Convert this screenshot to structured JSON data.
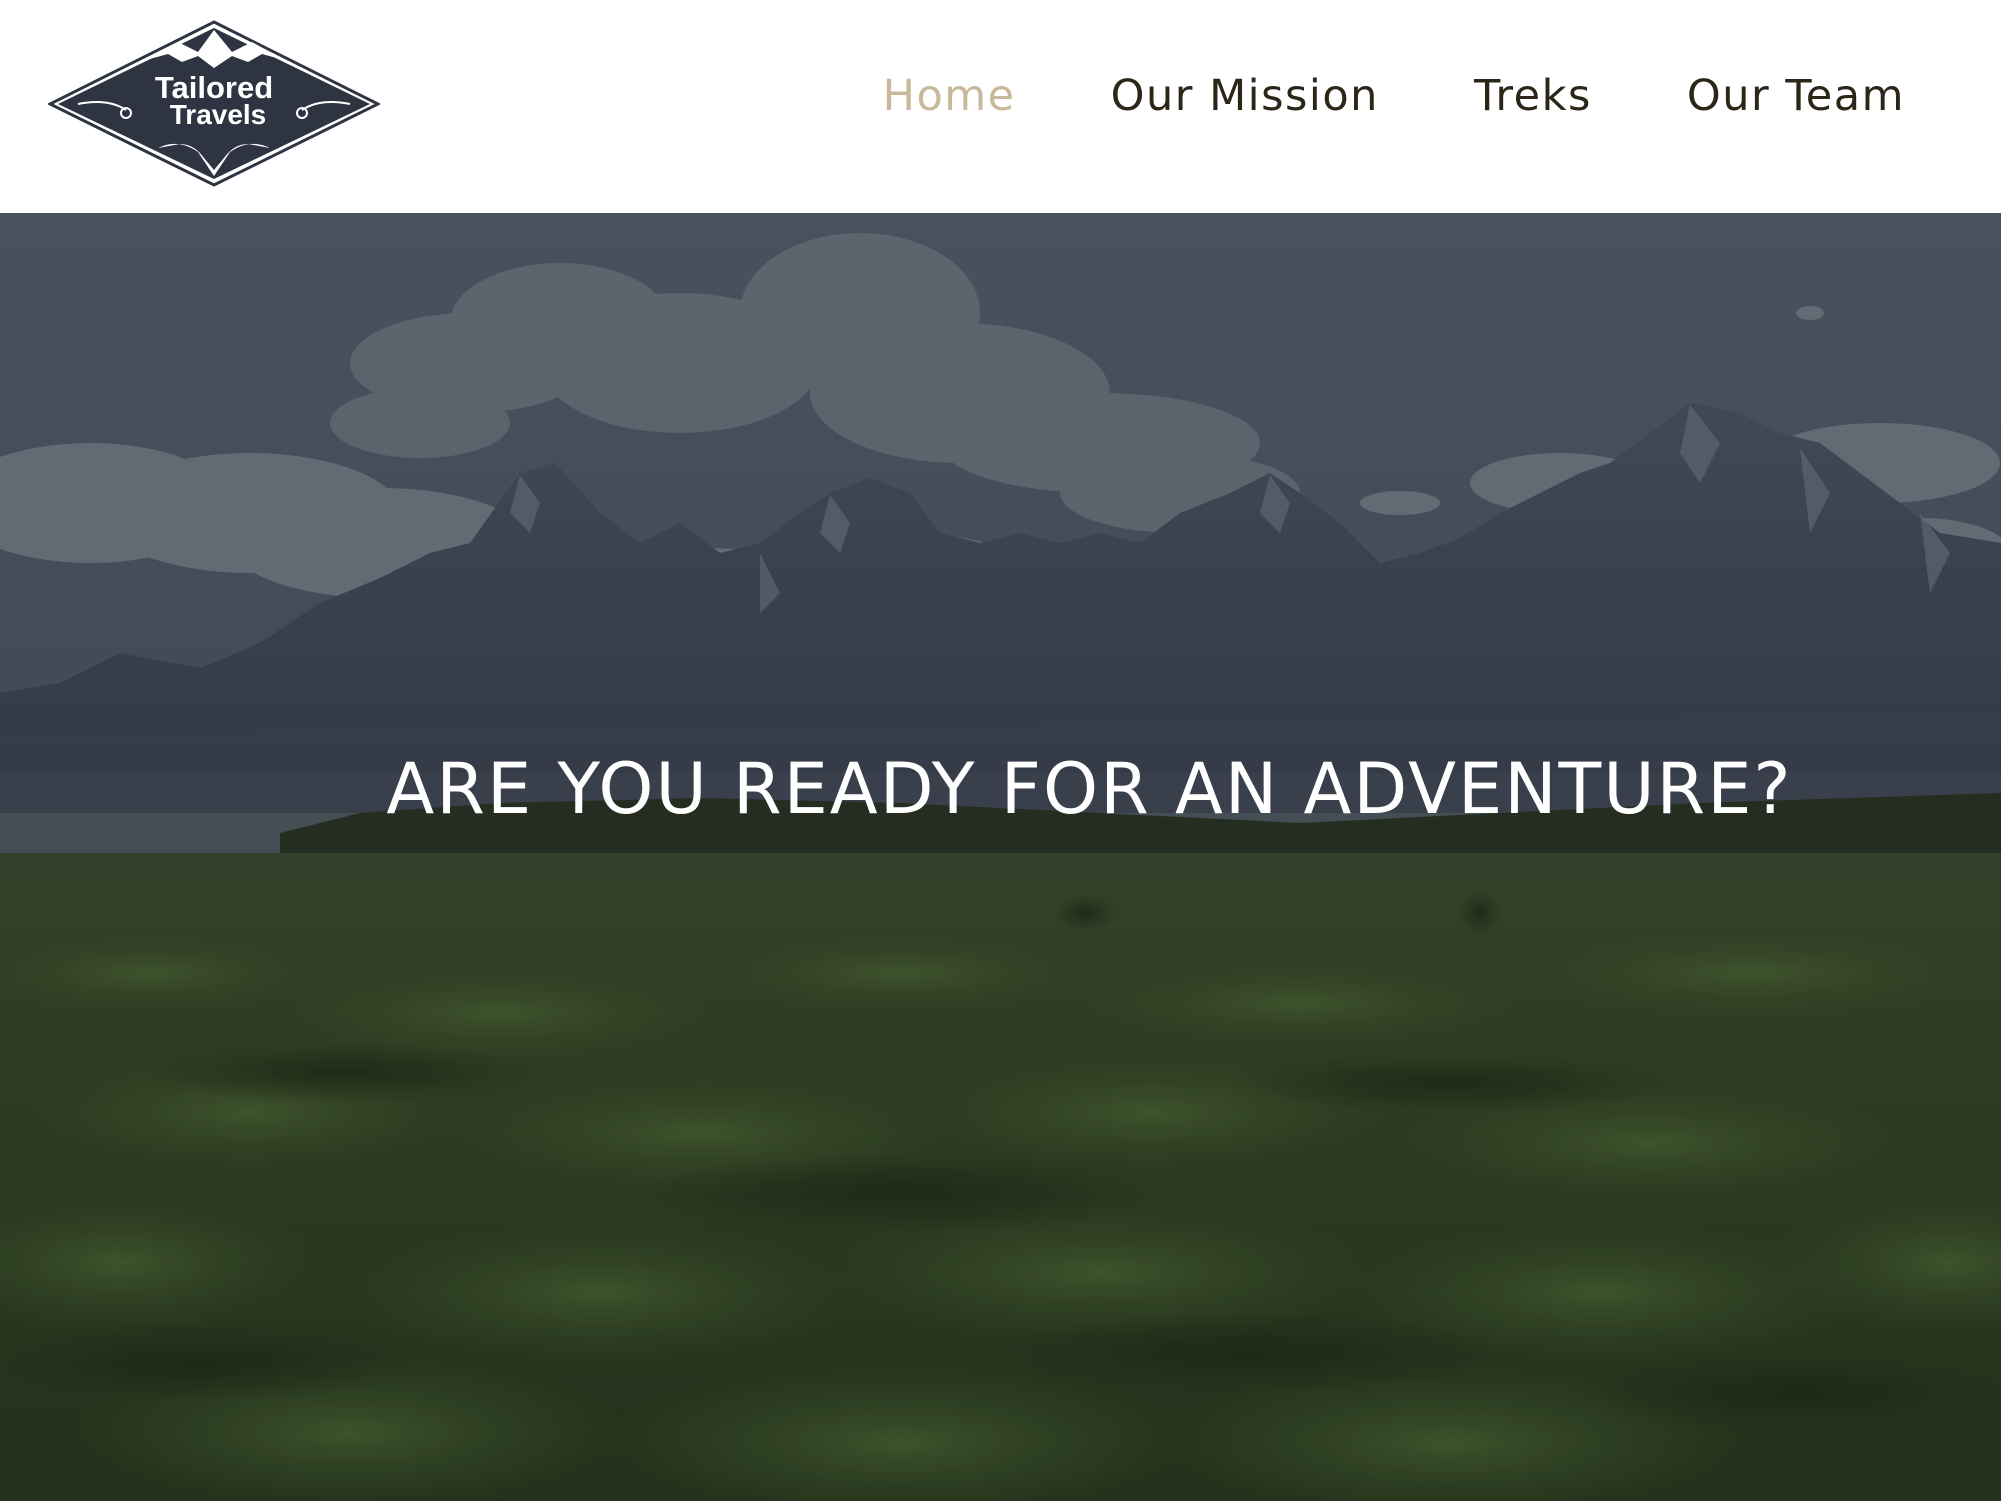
{
  "brand": {
    "logo_line1": "Tailored",
    "logo_line2": "Travels"
  },
  "nav": {
    "items": [
      {
        "label": "Home",
        "active": true
      },
      {
        "label": "Our Mission",
        "active": false
      },
      {
        "label": "Treks",
        "active": false
      },
      {
        "label": "Our Team",
        "active": false
      }
    ]
  },
  "hero": {
    "heading": "ARE YOU READY FOR AN ADVENTURE?"
  },
  "colors": {
    "nav_text": "#2b2618",
    "nav_active": "#c8b99a",
    "logo_fill": "#2f3443"
  }
}
